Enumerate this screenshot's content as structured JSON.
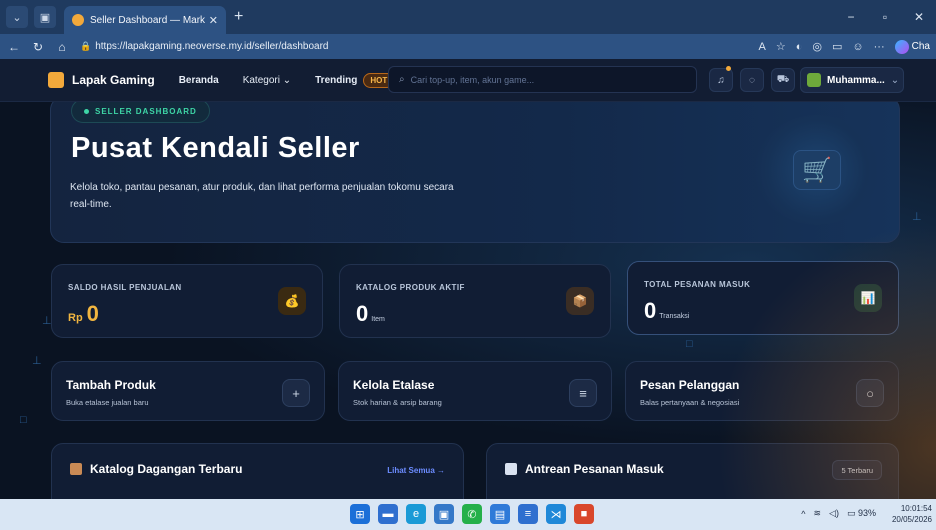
{
  "browser": {
    "tab_title": "Seller Dashboard — Marketplace",
    "tab_close": "✕",
    "new_tab": "+",
    "url": "https://lapakgaming.neoverse.my.id/seller/dashboard",
    "copilot_label": "Cha"
  },
  "header": {
    "brand": "Lapak Gaming",
    "nav": {
      "home": "Beranda",
      "category": "Kategori",
      "category_chevron": "⌄",
      "trending": "Trending",
      "hot_badge": "HOT"
    },
    "search_placeholder": "Cari top-up, item, akun game...",
    "user_name": "Muhamma...",
    "user_chevron": "⌄"
  },
  "hero": {
    "badge": "SELLER DASHBOARD",
    "title": "Pusat Kendali Seller",
    "description": "Kelola toko, pantau pesanan, atur produk, dan lihat performa penjualan tokomu secara real-time."
  },
  "stats": [
    {
      "label": "SALDO HASIL PENJUALAN",
      "prefix": "Rp",
      "value": "0",
      "unit": "",
      "icon": "money-bag-icon",
      "icon_glyph": "💰"
    },
    {
      "label": "KATALOG PRODUK AKTIF",
      "prefix": "",
      "value": "0",
      "unit": "Item",
      "icon": "package-icon",
      "icon_glyph": "📦"
    },
    {
      "label": "TOTAL PESANAN MASUK",
      "prefix": "",
      "value": "0",
      "unit": "Transaksi",
      "icon": "chart-icon",
      "icon_glyph": "📊"
    }
  ],
  "actions": [
    {
      "title": "Tambah Produk",
      "subtitle": "Buka etalase jualan baru",
      "icon": "plus-icon",
      "glyph": "+"
    },
    {
      "title": "Kelola Etalase",
      "subtitle": "Stok harian & arsip barang",
      "icon": "list-icon",
      "glyph": "≡"
    },
    {
      "title": "Pesan Pelanggan",
      "subtitle": "Balas pertanyaan & negosiasi",
      "icon": "chat-icon",
      "glyph": "○"
    }
  ],
  "panels": {
    "catalog": {
      "title": "Katalog Dagangan Terbaru",
      "link": "Lihat Semua →"
    },
    "orders": {
      "title": "Antrean Pesanan Masuk",
      "pill": "5 Terbaru"
    }
  },
  "taskbar": {
    "battery": "93%",
    "time": "10:01:54",
    "date": "20/05/2026"
  },
  "colors": {
    "accent_gold": "#f2b640",
    "accent_green": "#3ed6a6",
    "link_blue": "#6c8cff",
    "card_bg": "#111d34"
  }
}
